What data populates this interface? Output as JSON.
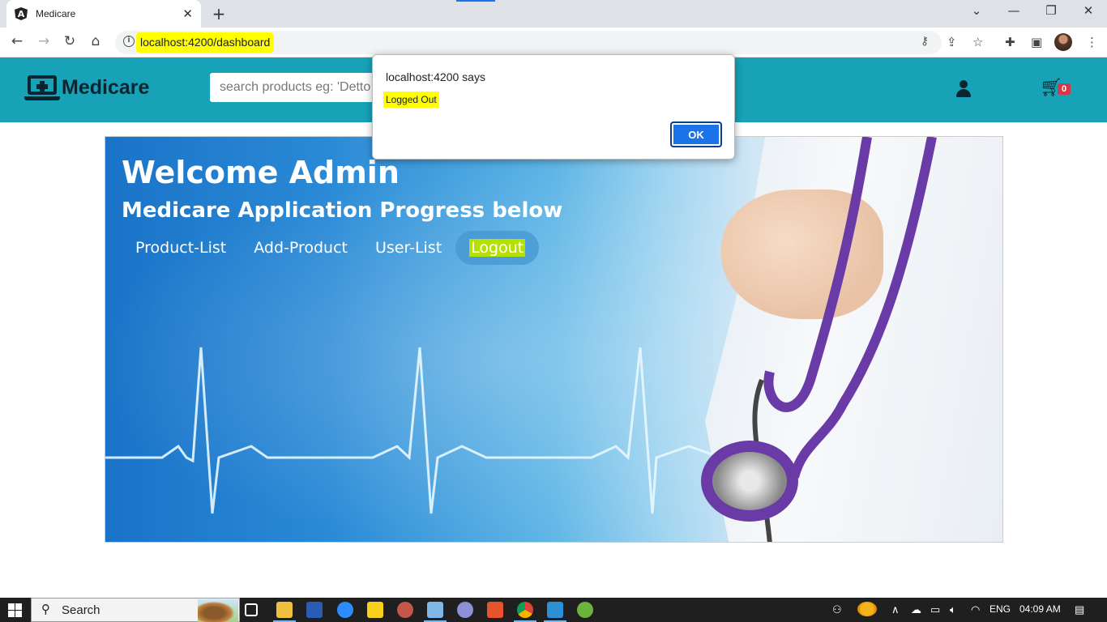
{
  "browser": {
    "tab_title": "Medicare",
    "tab_close": "✕",
    "new_tab": "+",
    "url": "localhost:4200/dashboard",
    "window_controls": [
      "⌄",
      "—",
      "❐",
      "✕"
    ]
  },
  "app": {
    "brand": "Medicare",
    "search_placeholder": "search products eg: 'Detto",
    "cart_count": "0"
  },
  "hero": {
    "title": "Welcome Admin",
    "subtitle": "Medicare Application Progress below",
    "nav": [
      {
        "label": "Product-List"
      },
      {
        "label": "Add-Product"
      },
      {
        "label": "User-List"
      },
      {
        "label": "Logout"
      }
    ]
  },
  "dialog": {
    "heading": "localhost:4200 says",
    "message": "Logged Out",
    "ok_label": "OK"
  },
  "taskbar": {
    "search_label": "Search",
    "language": "ENG",
    "time": "04:09 AM"
  },
  "colors": {
    "appbar": "#17a2b8",
    "highlight": "#ffff00",
    "dialog_button": "#1a73e8",
    "cart_badge": "#dc3545"
  }
}
